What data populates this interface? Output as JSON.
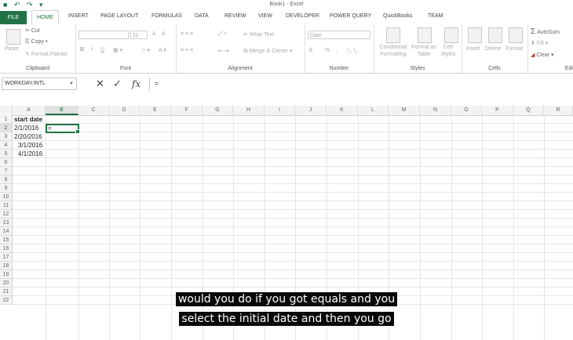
{
  "window": {
    "title": "Book1 - Excel"
  },
  "ribbon_tabs": [
    {
      "label": "FILE"
    },
    {
      "label": "HOME"
    },
    {
      "label": "INSERT"
    },
    {
      "label": "PAGE LAYOUT"
    },
    {
      "label": "FORMULAS"
    },
    {
      "label": "DATA"
    },
    {
      "label": "REVIEW"
    },
    {
      "label": "VIEW"
    },
    {
      "label": "DEVELOPER"
    },
    {
      "label": "POWER QUERY"
    },
    {
      "label": "QuickBooks"
    },
    {
      "label": "TEAM"
    }
  ],
  "clipboard": {
    "group_label": "Clipboard",
    "paste": "Paste",
    "cut": "Cut",
    "copy": "Copy",
    "format_painter": "Format Painter"
  },
  "font": {
    "group_label": "Font",
    "size": "11",
    "bold": "B",
    "italic": "I",
    "underline": "U",
    "grow": "A",
    "shrink": "A"
  },
  "alignment": {
    "group_label": "Alignment",
    "wrap_text": "Wrap Text",
    "merge_center": "Merge & Center"
  },
  "number": {
    "group_label": "Number",
    "format": "Date",
    "currency": "$",
    "percent": "%",
    "comma": ","
  },
  "styles": {
    "group_label": "Styles",
    "conditional": "Conditional Formatting",
    "format_table": "Format as Table",
    "cell_styles": "Cell Styles"
  },
  "cells": {
    "group_label": "Cells",
    "insert": "Insert",
    "delete": "Delete",
    "format": "Format"
  },
  "editing": {
    "group_label": "Edi",
    "autosum": "AutoSum",
    "fill": "Fill",
    "clear": "Clear"
  },
  "formula_bar": {
    "name_box": "WORKDAY.INTL",
    "cancel": "✕",
    "enter": "✓",
    "fx": "fx",
    "content": "="
  },
  "columns": [
    "A",
    "B",
    "C",
    "D",
    "E",
    "F",
    "G",
    "H",
    "I",
    "J",
    "K",
    "L",
    "M",
    "N",
    "O",
    "P",
    "Q",
    "R"
  ],
  "rows": [
    "1",
    "2",
    "3",
    "4",
    "5",
    "6",
    "7",
    "8",
    "9",
    "10",
    "11",
    "12",
    "13",
    "14",
    "15",
    "16",
    "17",
    "18",
    "19",
    "20",
    "21",
    "22"
  ],
  "cells_data": {
    "A1": "start date",
    "A2": "2/1/2016",
    "A3": "2/20/2016",
    "A4": "3/1/2016",
    "A5": "4/1/2016",
    "B2": "="
  },
  "subtitles": [
    "would you do if you got equals and you",
    "select the initial date and then you go"
  ],
  "colors": {
    "excel_green": "#217346",
    "subtitle_bg": "#080808"
  }
}
